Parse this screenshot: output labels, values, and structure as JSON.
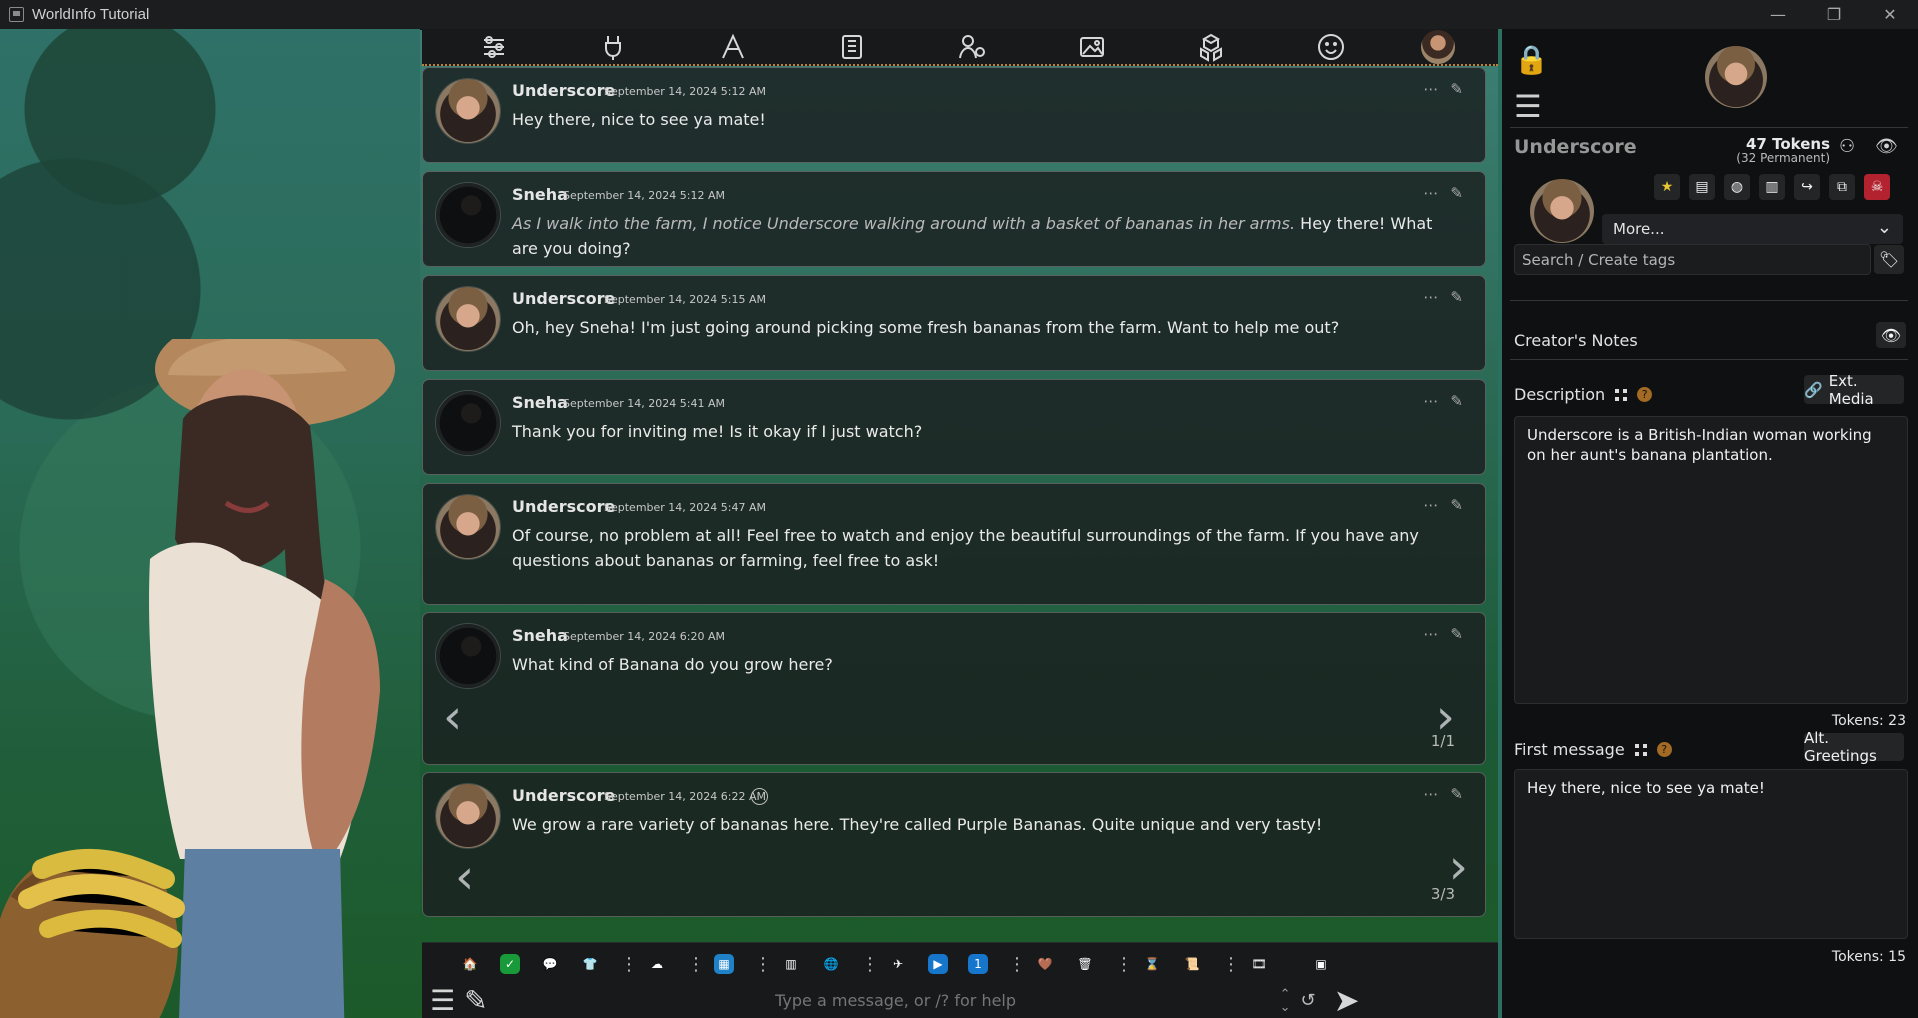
{
  "window": {
    "title": "WorldInfo Tutorial",
    "controls": [
      "—",
      "❐",
      "✕"
    ]
  },
  "topbar": {
    "icons": [
      {
        "name": "settings-sliders-icon"
      },
      {
        "name": "plug-icon"
      },
      {
        "name": "font-icon"
      },
      {
        "name": "book-icon"
      },
      {
        "name": "user-gear-icon"
      },
      {
        "name": "image-icon"
      },
      {
        "name": "cubes-icon"
      },
      {
        "name": "smile-icon"
      },
      {
        "name": "profile-avatar"
      }
    ]
  },
  "chat": {
    "messages": [
      {
        "sender": "Underscore",
        "time": "September 14, 2024 5:12 AM",
        "text": "Hey there, nice to see ya mate!",
        "avatar": "underscore"
      },
      {
        "sender": "Sneha",
        "time": "September 14, 2024 5:12 AM",
        "text_italic": "As I walk into the farm, I notice Underscore walking around with a basket of bananas in her arms.",
        "text_normal": "Hey there! What are you doing?",
        "avatar": "sneha"
      },
      {
        "sender": "Underscore",
        "time": "September 14, 2024 5:15 AM",
        "text": "Oh, hey Sneha! I'm just going around picking some fresh bananas from the farm. Want to help me out?",
        "avatar": "underscore"
      },
      {
        "sender": "Sneha",
        "time": "September 14, 2024 5:41 AM",
        "text": "Thank you for inviting me! Is it okay if I just watch?",
        "avatar": "sneha"
      },
      {
        "sender": "Underscore",
        "time": "September 14, 2024 5:47 AM",
        "text": "Of course, no problem at all! Feel free to watch and enjoy the beautiful surroundings of the farm. If you have any questions about bananas or farming, feel free to ask!",
        "avatar": "underscore"
      },
      {
        "sender": "Sneha",
        "time": "September 14, 2024 6:20 AM",
        "text": "What kind of Banana do you grow here?",
        "avatar": "sneha",
        "swipe": "1/1"
      },
      {
        "sender": "Underscore",
        "time": "September 14, 2024 6:22 AM",
        "text": "We grow a rare variety of bananas here. They're called Purple Bananas. Quite unique and very tasty!",
        "avatar": "underscore",
        "swipe": "3/3"
      }
    ]
  },
  "bottombar": {
    "placeholder": "Type a message, or /? for help",
    "extensions": [
      "🏠",
      "✓",
      "💬",
      "👕",
      "⋮",
      "☁",
      "⋮",
      "▦",
      "⋮",
      "▥",
      "🌐",
      "⋮",
      "✈",
      "▶",
      "1",
      "⋮",
      "🤎",
      "🗑",
      "⋮",
      "⌛",
      "📜",
      "⋮",
      "🎞",
      "▣"
    ]
  },
  "panel": {
    "character_name": "Underscore",
    "tokens_main": "47 Tokens",
    "tokens_permanent": "(32 Permanent)",
    "more_label": "More...",
    "tags_placeholder": "Search / Create tags",
    "creators_notes": "Creator's Notes",
    "description_label": "Description",
    "ext_media_label": "Ext. Media",
    "description": "Underscore is a British-Indian woman working on her aunt's banana plantation.",
    "description_tokens": "Tokens: 23",
    "first_message_label": "First message",
    "alt_greetings_label": "Alt. Greetings",
    "first_message": "Hey there, nice to see ya mate!",
    "first_message_tokens": "Tokens: 15"
  },
  "colors": {
    "accent": "#b98437",
    "panel_bg": "#0f1011",
    "chat_bg": "#1b1f1f",
    "help": "#a36a23",
    "danger": "#b3232f"
  }
}
